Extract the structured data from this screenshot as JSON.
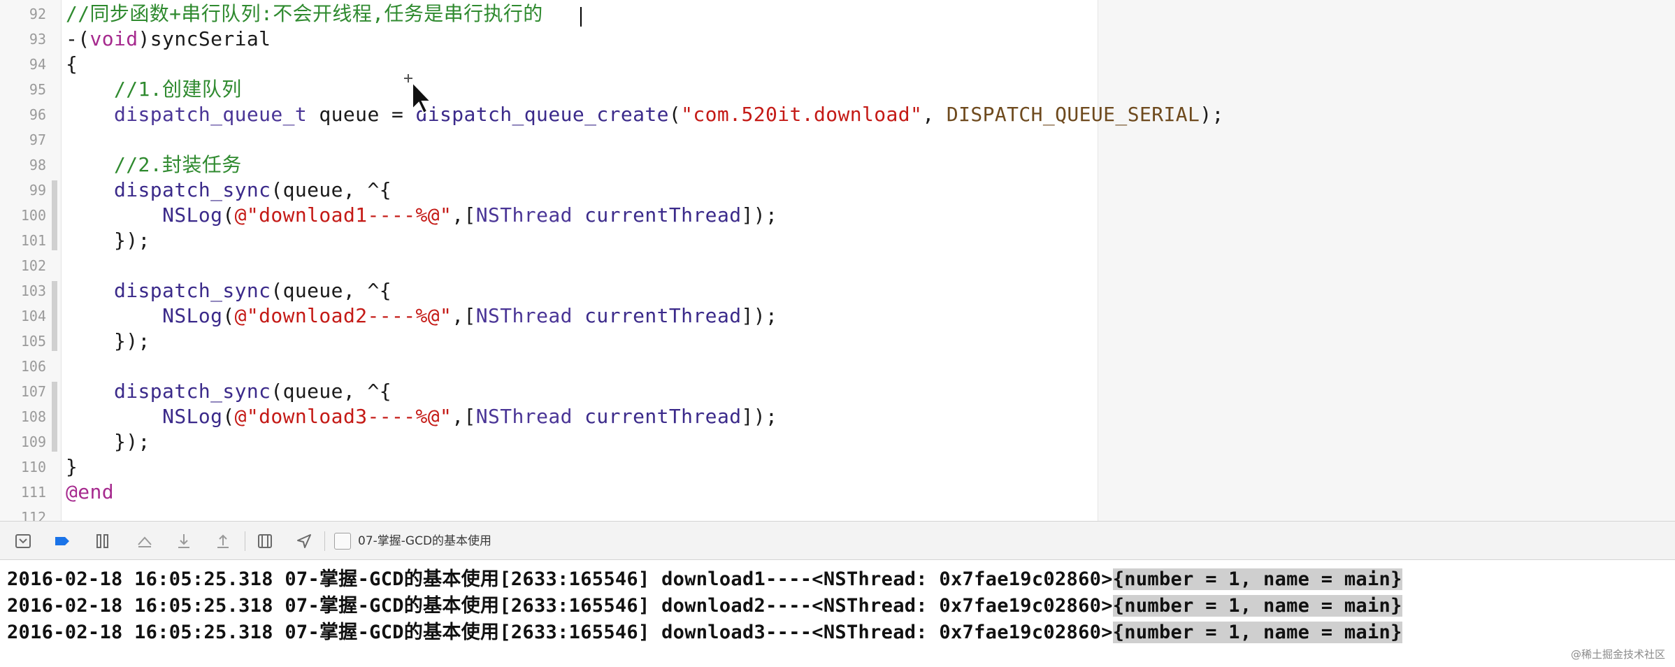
{
  "editor": {
    "lines": [
      {
        "num": "92",
        "tokens": [
          {
            "t": "//同步函数+串行队列:不会开线程,任务是串行执行的",
            "c": "comment"
          }
        ]
      },
      {
        "num": "93",
        "tokens": [
          {
            "t": "-(",
            "c": "plain"
          },
          {
            "t": "void",
            "c": "keyword"
          },
          {
            "t": ")syncSerial",
            "c": "plain"
          }
        ]
      },
      {
        "num": "94",
        "tokens": [
          {
            "t": "{",
            "c": "plain"
          }
        ]
      },
      {
        "num": "95",
        "tokens": [
          {
            "t": "    //1.创建队列",
            "c": "comment"
          }
        ]
      },
      {
        "num": "96",
        "tokens": [
          {
            "t": "    ",
            "c": "plain"
          },
          {
            "t": "dispatch_queue_t",
            "c": "type"
          },
          {
            "t": " queue = ",
            "c": "plain"
          },
          {
            "t": "dispatch_queue_create",
            "c": "func"
          },
          {
            "t": "(",
            "c": "plain"
          },
          {
            "t": "\"com.520it.download\"",
            "c": "string"
          },
          {
            "t": ", ",
            "c": "plain"
          },
          {
            "t": "DISPATCH_QUEUE_SERIAL",
            "c": "macro"
          },
          {
            "t": ");",
            "c": "plain"
          }
        ]
      },
      {
        "num": "97",
        "tokens": []
      },
      {
        "num": "98",
        "tokens": [
          {
            "t": "    //2.封装任务",
            "c": "comment"
          }
        ]
      },
      {
        "num": "99",
        "tokens": [
          {
            "t": "    ",
            "c": "plain"
          },
          {
            "t": "dispatch_sync",
            "c": "func"
          },
          {
            "t": "(queue, ^{",
            "c": "plain"
          }
        ]
      },
      {
        "num": "100",
        "tokens": [
          {
            "t": "        ",
            "c": "plain"
          },
          {
            "t": "NSLog",
            "c": "func"
          },
          {
            "t": "(",
            "c": "plain"
          },
          {
            "t": "@\"download1----%@\"",
            "c": "string"
          },
          {
            "t": ",[",
            "c": "plain"
          },
          {
            "t": "NSThread",
            "c": "type"
          },
          {
            "t": " ",
            "c": "plain"
          },
          {
            "t": "currentThread",
            "c": "func"
          },
          {
            "t": "]);",
            "c": "plain"
          }
        ]
      },
      {
        "num": "101",
        "tokens": [
          {
            "t": "    });",
            "c": "plain"
          }
        ]
      },
      {
        "num": "102",
        "tokens": []
      },
      {
        "num": "103",
        "tokens": [
          {
            "t": "    ",
            "c": "plain"
          },
          {
            "t": "dispatch_sync",
            "c": "func"
          },
          {
            "t": "(queue, ^{",
            "c": "plain"
          }
        ]
      },
      {
        "num": "104",
        "tokens": [
          {
            "t": "        ",
            "c": "plain"
          },
          {
            "t": "NSLog",
            "c": "func"
          },
          {
            "t": "(",
            "c": "plain"
          },
          {
            "t": "@\"download2----%@\"",
            "c": "string"
          },
          {
            "t": ",[",
            "c": "plain"
          },
          {
            "t": "NSThread",
            "c": "type"
          },
          {
            "t": " ",
            "c": "plain"
          },
          {
            "t": "currentThread",
            "c": "func"
          },
          {
            "t": "]);",
            "c": "plain"
          }
        ]
      },
      {
        "num": "105",
        "tokens": [
          {
            "t": "    });",
            "c": "plain"
          }
        ]
      },
      {
        "num": "106",
        "tokens": []
      },
      {
        "num": "107",
        "tokens": [
          {
            "t": "    ",
            "c": "plain"
          },
          {
            "t": "dispatch_sync",
            "c": "func"
          },
          {
            "t": "(queue, ^{",
            "c": "plain"
          }
        ]
      },
      {
        "num": "108",
        "tokens": [
          {
            "t": "        ",
            "c": "plain"
          },
          {
            "t": "NSLog",
            "c": "func"
          },
          {
            "t": "(",
            "c": "plain"
          },
          {
            "t": "@\"download3----%@\"",
            "c": "string"
          },
          {
            "t": ",[",
            "c": "plain"
          },
          {
            "t": "NSThread",
            "c": "type"
          },
          {
            "t": " ",
            "c": "plain"
          },
          {
            "t": "currentThread",
            "c": "func"
          },
          {
            "t": "]);",
            "c": "plain"
          }
        ]
      },
      {
        "num": "109",
        "tokens": [
          {
            "t": "    });",
            "c": "plain"
          }
        ]
      },
      {
        "num": "110",
        "tokens": [
          {
            "t": "}",
            "c": "plain"
          }
        ]
      },
      {
        "num": "111",
        "tokens": [
          {
            "t": "@end",
            "c": "keyword"
          }
        ]
      },
      {
        "num": "112",
        "tokens": []
      }
    ],
    "change_bars": [
      "99-101",
      "103-105",
      "107-109"
    ]
  },
  "debug_bar": {
    "icons": [
      "hide-debug-area-icon",
      "breakpoints-toggle-icon",
      "pause-icon",
      "step-over-icon",
      "step-into-icon",
      "step-out-icon",
      "view-hierarchy-icon",
      "location-icon"
    ],
    "target_label": "07-掌握-GCD的基本使用"
  },
  "console": {
    "lines": [
      {
        "prefix": "2016-02-18 16:05:25.318 07-掌握-GCD的基本使用[2633:165546] download1----<NSThread: 0x7fae19c02860>",
        "highlighted": "{number = 1, name = main}"
      },
      {
        "prefix": "2016-02-18 16:05:25.318 07-掌握-GCD的基本使用[2633:165546] download2----<NSThread: 0x7fae19c02860>",
        "highlighted": "{number = 1, name = main}"
      },
      {
        "prefix": "2016-02-18 16:05:25.318 07-掌握-GCD的基本使用[2633:165546] download3----<NSThread: 0x7fae19c02860>",
        "highlighted": "{number = 1, name = main}"
      }
    ]
  },
  "watermark": "@稀土掘金技术社区"
}
